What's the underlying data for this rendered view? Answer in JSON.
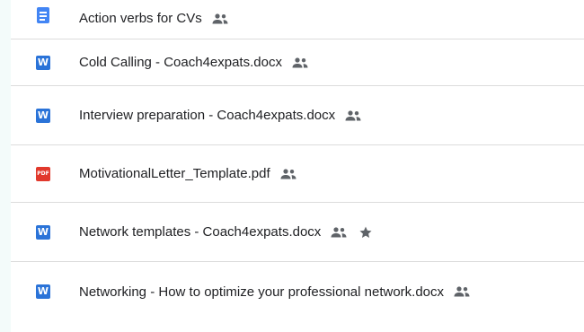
{
  "files": [
    {
      "name": "Action verbs for CVs",
      "type_icon": "google-docs-icon",
      "type_label": "",
      "shared": true,
      "starred": false
    },
    {
      "name": "Cold Calling - Coach4expats.docx",
      "type_icon": "word-icon",
      "type_label": "W",
      "shared": true,
      "starred": false
    },
    {
      "name": "Interview preparation - Coach4expats.docx",
      "type_icon": "word-icon",
      "type_label": "W",
      "shared": true,
      "starred": false
    },
    {
      "name": "MotivationalLetter_Template.pdf",
      "type_icon": "pdf-icon",
      "type_label": "PDF",
      "shared": true,
      "starred": false
    },
    {
      "name": "Network templates - Coach4expats.docx",
      "type_icon": "word-icon",
      "type_label": "W",
      "shared": true,
      "starred": true
    },
    {
      "name": "Networking - How to optimize your professional network.docx",
      "type_icon": "word-icon",
      "type_label": "W",
      "shared": true,
      "starred": false
    }
  ],
  "icons": {
    "shared": "people-icon",
    "star": "star-icon"
  },
  "colors": {
    "docs_blue": "#4285f4",
    "word_blue": "#2a73d8",
    "pdf_red": "#e1392c",
    "icon_gray": "#5f6368",
    "text": "#202124",
    "divider": "#dcdcdc"
  }
}
